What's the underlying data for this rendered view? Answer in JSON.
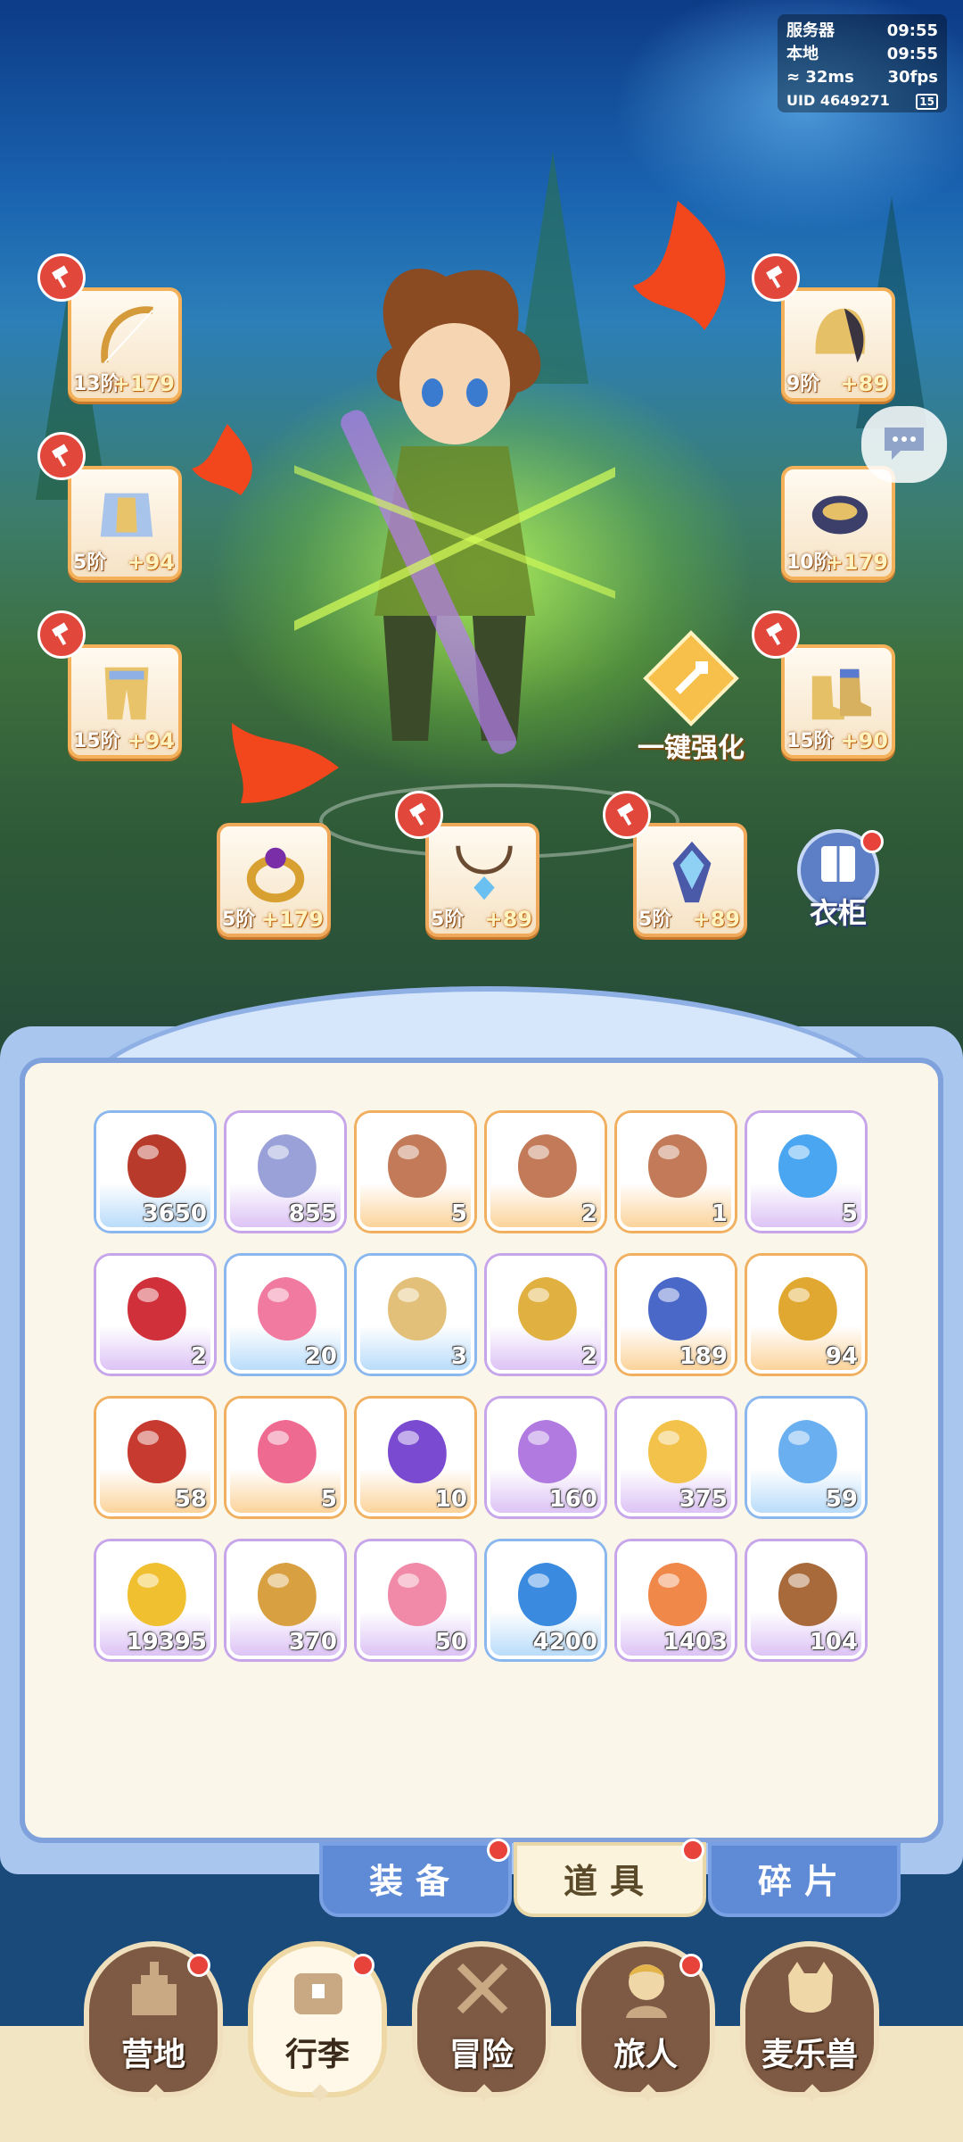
{
  "hud": {
    "server_label": "服务器",
    "server_time": "09:55",
    "local_label": "本地",
    "local_time": "09:55",
    "ping": "32ms",
    "fps": "30fps",
    "uid_label": "UID",
    "uid": "4649271",
    "battery": "15"
  },
  "equipment": {
    "left": [
      {
        "name": "bow",
        "tier": "13阶",
        "bonus": "+179"
      },
      {
        "name": "chest-armor",
        "tier": "5阶",
        "bonus": "+94"
      },
      {
        "name": "leg-armor",
        "tier": "15阶",
        "bonus": "+94"
      }
    ],
    "right": [
      {
        "name": "helmet",
        "tier": "9阶",
        "bonus": "+89"
      },
      {
        "name": "gauntlets",
        "tier": "10阶",
        "bonus": "+179"
      },
      {
        "name": "boots",
        "tier": "15阶",
        "bonus": "+90"
      }
    ],
    "bottom": [
      {
        "name": "ring",
        "tier": "5阶",
        "bonus": "+179"
      },
      {
        "name": "necklace",
        "tier": "5阶",
        "bonus": "+89"
      },
      {
        "name": "amulet",
        "tier": "5阶",
        "bonus": "+89"
      }
    ]
  },
  "actions": {
    "auto_upgrade": "一键强化",
    "wardrobe": "衣柜"
  },
  "inventory": {
    "rows": [
      [
        {
          "icon": "red-fur-icon",
          "rarity": "blue",
          "count": "3650"
        },
        {
          "icon": "silver-heart-coin-icon",
          "rarity": "purple",
          "count": "855"
        },
        {
          "icon": "ore-sword-icon",
          "rarity": "orange",
          "count": "5"
        },
        {
          "icon": "ore-armor-icon",
          "rarity": "orange",
          "count": "2"
        },
        {
          "icon": "ore-boots-icon",
          "rarity": "orange",
          "count": "1"
        },
        {
          "icon": "blue-potion-icon",
          "rarity": "purple",
          "count": "5"
        }
      ],
      [
        {
          "icon": "red-potion-icon",
          "rarity": "purple",
          "count": "2"
        },
        {
          "icon": "paw-icon",
          "rarity": "blue",
          "count": "20"
        },
        {
          "icon": "rice-bowl-icon",
          "rarity": "blue",
          "count": "3"
        },
        {
          "icon": "gold-key-icon",
          "rarity": "purple",
          "count": "2"
        },
        {
          "icon": "blue-card-icon",
          "rarity": "orange",
          "count": "189"
        },
        {
          "icon": "gold-card-icon",
          "rarity": "orange",
          "count": "94"
        }
      ],
      [
        {
          "icon": "red-card-icon",
          "rarity": "orange",
          "count": "58"
        },
        {
          "icon": "pink-card-icon",
          "rarity": "orange",
          "count": "5"
        },
        {
          "icon": "rainbow-crystal-icon",
          "rarity": "orange",
          "count": "10"
        },
        {
          "icon": "cat-orb-icon",
          "rarity": "purple",
          "count": "160"
        },
        {
          "icon": "cheese-icon",
          "rarity": "purple",
          "count": "375"
        },
        {
          "icon": "wind-orb-icon",
          "rarity": "blue",
          "count": "59"
        }
      ],
      [
        {
          "icon": "gold-leaf-icon",
          "rarity": "purple",
          "count": "19395"
        },
        {
          "icon": "star-cookie-icon",
          "rarity": "purple",
          "count": "370"
        },
        {
          "icon": "paint-tube-icon",
          "rarity": "purple",
          "count": "50"
        },
        {
          "icon": "blue-jelly-icon",
          "rarity": "blue",
          "count": "4200"
        },
        {
          "icon": "ticket-icon",
          "rarity": "purple",
          "count": "1403"
        },
        {
          "icon": "book-icon",
          "rarity": "purple",
          "count": "104"
        }
      ]
    ]
  },
  "tabs": [
    {
      "label": "装备",
      "active": false
    },
    {
      "label": "道具",
      "active": true
    },
    {
      "label": "碎片",
      "active": false
    }
  ],
  "nav": [
    {
      "label": "营地",
      "active": false
    },
    {
      "label": "行李",
      "active": true
    },
    {
      "label": "冒险",
      "active": false
    },
    {
      "label": "旅人",
      "active": false
    },
    {
      "label": "麦乐兽",
      "active": false
    }
  ],
  "colors": {
    "blue": "#8ab8ee",
    "purple": "#c7a5ea",
    "orange": "#f0b060",
    "red_dot": "#e8433a"
  }
}
